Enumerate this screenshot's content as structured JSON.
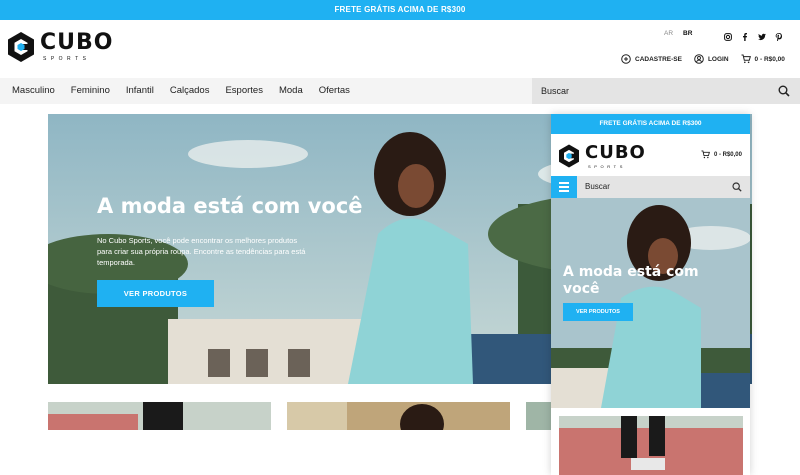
{
  "promo": "FRETE GRÁTIS ACIMA DE R$300",
  "brand": {
    "name": "CUBO",
    "tagline": "SPORTS",
    "accent": "#1fb1f2"
  },
  "languages": [
    "AR",
    "BR"
  ],
  "social_icons": [
    "instagram-icon",
    "facebook-icon",
    "twitter-icon",
    "pinterest-icon"
  ],
  "header_actions": {
    "signup": "CADASTRE-SE",
    "login": "LOGIN",
    "cart": "0 - R$0,00"
  },
  "nav": {
    "items": [
      "Masculino",
      "Feminino",
      "Infantil",
      "Calçados",
      "Esportes",
      "Moda",
      "Ofertas"
    ]
  },
  "search": {
    "placeholder": "Buscar"
  },
  "hero": {
    "title": "A moda está com você",
    "text": "No Cubo Sports, você pode encontrar os melhores produtos para criar sua própria roupa. Encontre as tendências para está temporada.",
    "button": "VER PRODUTOS"
  },
  "mobile": {
    "promo": "FRETE GRÁTIS ACIMA DE R$300",
    "cart": "0 - R$0,00",
    "search_placeholder": "Buscar",
    "hero_title": "A moda está com você",
    "button": "VER PRODUTOS"
  }
}
